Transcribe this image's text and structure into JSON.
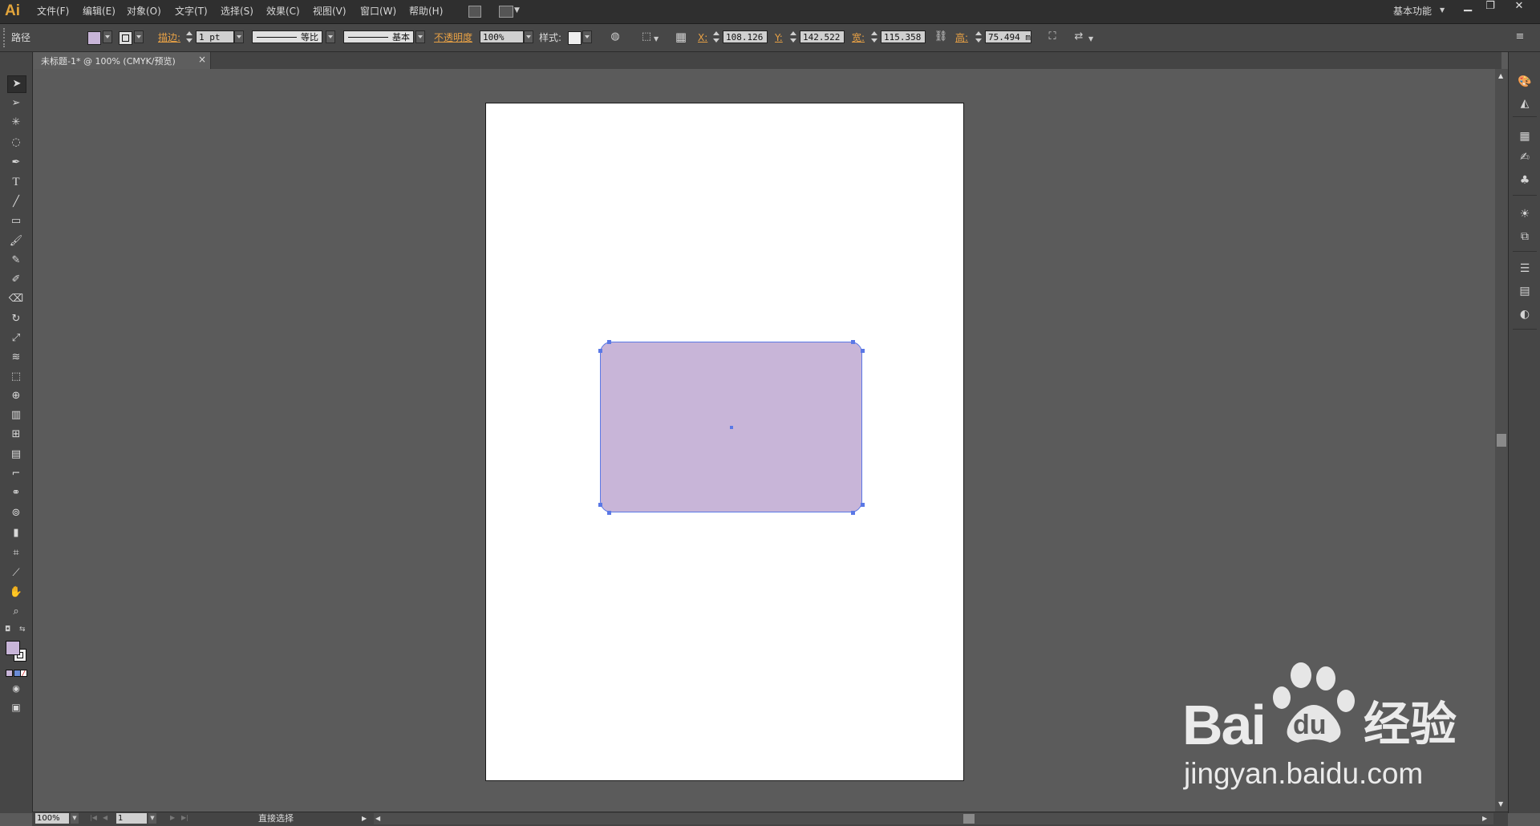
{
  "menubar": {
    "logo": "Ai",
    "items": [
      "文件(F)",
      "编辑(E)",
      "对象(O)",
      "文字(T)",
      "选择(S)",
      "效果(C)",
      "视图(V)",
      "窗口(W)",
      "帮助(H)"
    ],
    "workspace": "基本功能"
  },
  "controlbar": {
    "selection_label": "路径",
    "fill_color": "#c8b5d8",
    "stroke_label": "描边:",
    "stroke_weight": "1 pt",
    "profile": "等比",
    "brush": "基本",
    "opacity_label": "不透明度",
    "opacity": "100%",
    "style_label": "样式:",
    "x_label": "X:",
    "x_value": "108.126 i",
    "y_label": "Y:",
    "y_value": "142.522 i",
    "w_label": "宽:",
    "w_value": "115.358 i",
    "h_label": "高:",
    "h_value": "75.494 mi"
  },
  "document": {
    "tab_title": "未标题-1* @ 100% (CMYK/预览)",
    "close": "×"
  },
  "statusbar": {
    "zoom": "100%",
    "page": "1",
    "tool_status": "直接选择"
  },
  "colors": {
    "accent_orange": "#e8a145",
    "shape_fill": "#c8b5d8",
    "selection_blue": "#5a78e6"
  },
  "watermark": {
    "brand": "Bai",
    "brand2": "du",
    "cn": "经验",
    "url": "jingyan.baidu.com"
  }
}
